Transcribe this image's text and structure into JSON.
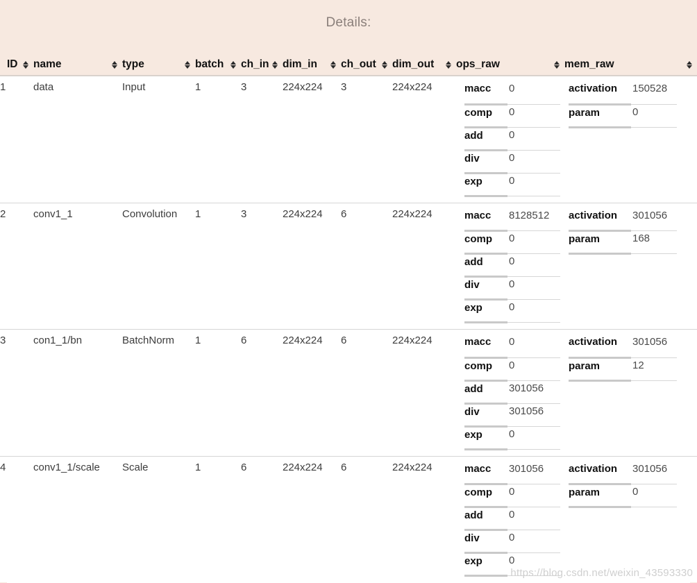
{
  "title": "Details:",
  "watermark": "https://blog.csdn.net/weixin_43593330",
  "colors": {
    "background": "#f7e9e0",
    "table_background": "#ffffff",
    "title_text": "#8a7f7a",
    "header_text": "#111111",
    "cell_text": "#3c3c3c",
    "row_divider": "#d6d6d6",
    "kv_key_underline": "#c9c9c9",
    "watermark_text": "#cfcfcf"
  },
  "table": {
    "sort_icon": "sort-updown-icon",
    "columns": [
      {
        "key": "id",
        "label": "ID",
        "sortable": true
      },
      {
        "key": "name",
        "label": "name",
        "sortable": true
      },
      {
        "key": "type",
        "label": "type",
        "sortable": true
      },
      {
        "key": "batch",
        "label": "batch",
        "sortable": true
      },
      {
        "key": "ch_in",
        "label": "ch_in",
        "sortable": true
      },
      {
        "key": "dim_in",
        "label": "dim_in",
        "sortable": true
      },
      {
        "key": "ch_out",
        "label": "ch_out",
        "sortable": true
      },
      {
        "key": "dim_out",
        "label": "dim_out",
        "sortable": true
      },
      {
        "key": "ops_raw",
        "label": "ops_raw",
        "sortable": true
      },
      {
        "key": "mem_raw",
        "label": "mem_raw",
        "sortable": true
      }
    ],
    "rows": [
      {
        "id": "1",
        "name": "data",
        "type": "Input",
        "batch": "1",
        "ch_in": "3",
        "dim_in": "224x224",
        "ch_out": "3",
        "dim_out": "224x224",
        "ops_raw": [
          {
            "key": "macc",
            "value": "0"
          },
          {
            "key": "comp",
            "value": "0"
          },
          {
            "key": "add",
            "value": "0"
          },
          {
            "key": "div",
            "value": "0"
          },
          {
            "key": "exp",
            "value": "0"
          }
        ],
        "mem_raw": [
          {
            "key": "activation",
            "value": "150528"
          },
          {
            "key": "param",
            "value": "0"
          }
        ]
      },
      {
        "id": "2",
        "name": "conv1_1",
        "type": "Convolution",
        "batch": "1",
        "ch_in": "3",
        "dim_in": "224x224",
        "ch_out": "6",
        "dim_out": "224x224",
        "ops_raw": [
          {
            "key": "macc",
            "value": "8128512"
          },
          {
            "key": "comp",
            "value": "0"
          },
          {
            "key": "add",
            "value": "0"
          },
          {
            "key": "div",
            "value": "0"
          },
          {
            "key": "exp",
            "value": "0"
          }
        ],
        "mem_raw": [
          {
            "key": "activation",
            "value": "301056"
          },
          {
            "key": "param",
            "value": "168"
          }
        ]
      },
      {
        "id": "3",
        "name": "con1_1/bn",
        "type": "BatchNorm",
        "batch": "1",
        "ch_in": "6",
        "dim_in": "224x224",
        "ch_out": "6",
        "dim_out": "224x224",
        "ops_raw": [
          {
            "key": "macc",
            "value": "0"
          },
          {
            "key": "comp",
            "value": "0"
          },
          {
            "key": "add",
            "value": "301056"
          },
          {
            "key": "div",
            "value": "301056"
          },
          {
            "key": "exp",
            "value": "0"
          }
        ],
        "mem_raw": [
          {
            "key": "activation",
            "value": "301056"
          },
          {
            "key": "param",
            "value": "12"
          }
        ]
      },
      {
        "id": "4",
        "name": "conv1_1/scale",
        "type": "Scale",
        "batch": "1",
        "ch_in": "6",
        "dim_in": "224x224",
        "ch_out": "6",
        "dim_out": "224x224",
        "ops_raw": [
          {
            "key": "macc",
            "value": "301056"
          },
          {
            "key": "comp",
            "value": "0"
          },
          {
            "key": "add",
            "value": "0"
          },
          {
            "key": "div",
            "value": "0"
          },
          {
            "key": "exp",
            "value": "0"
          }
        ],
        "mem_raw": [
          {
            "key": "activation",
            "value": "301056"
          },
          {
            "key": "param",
            "value": "0"
          }
        ]
      }
    ]
  }
}
